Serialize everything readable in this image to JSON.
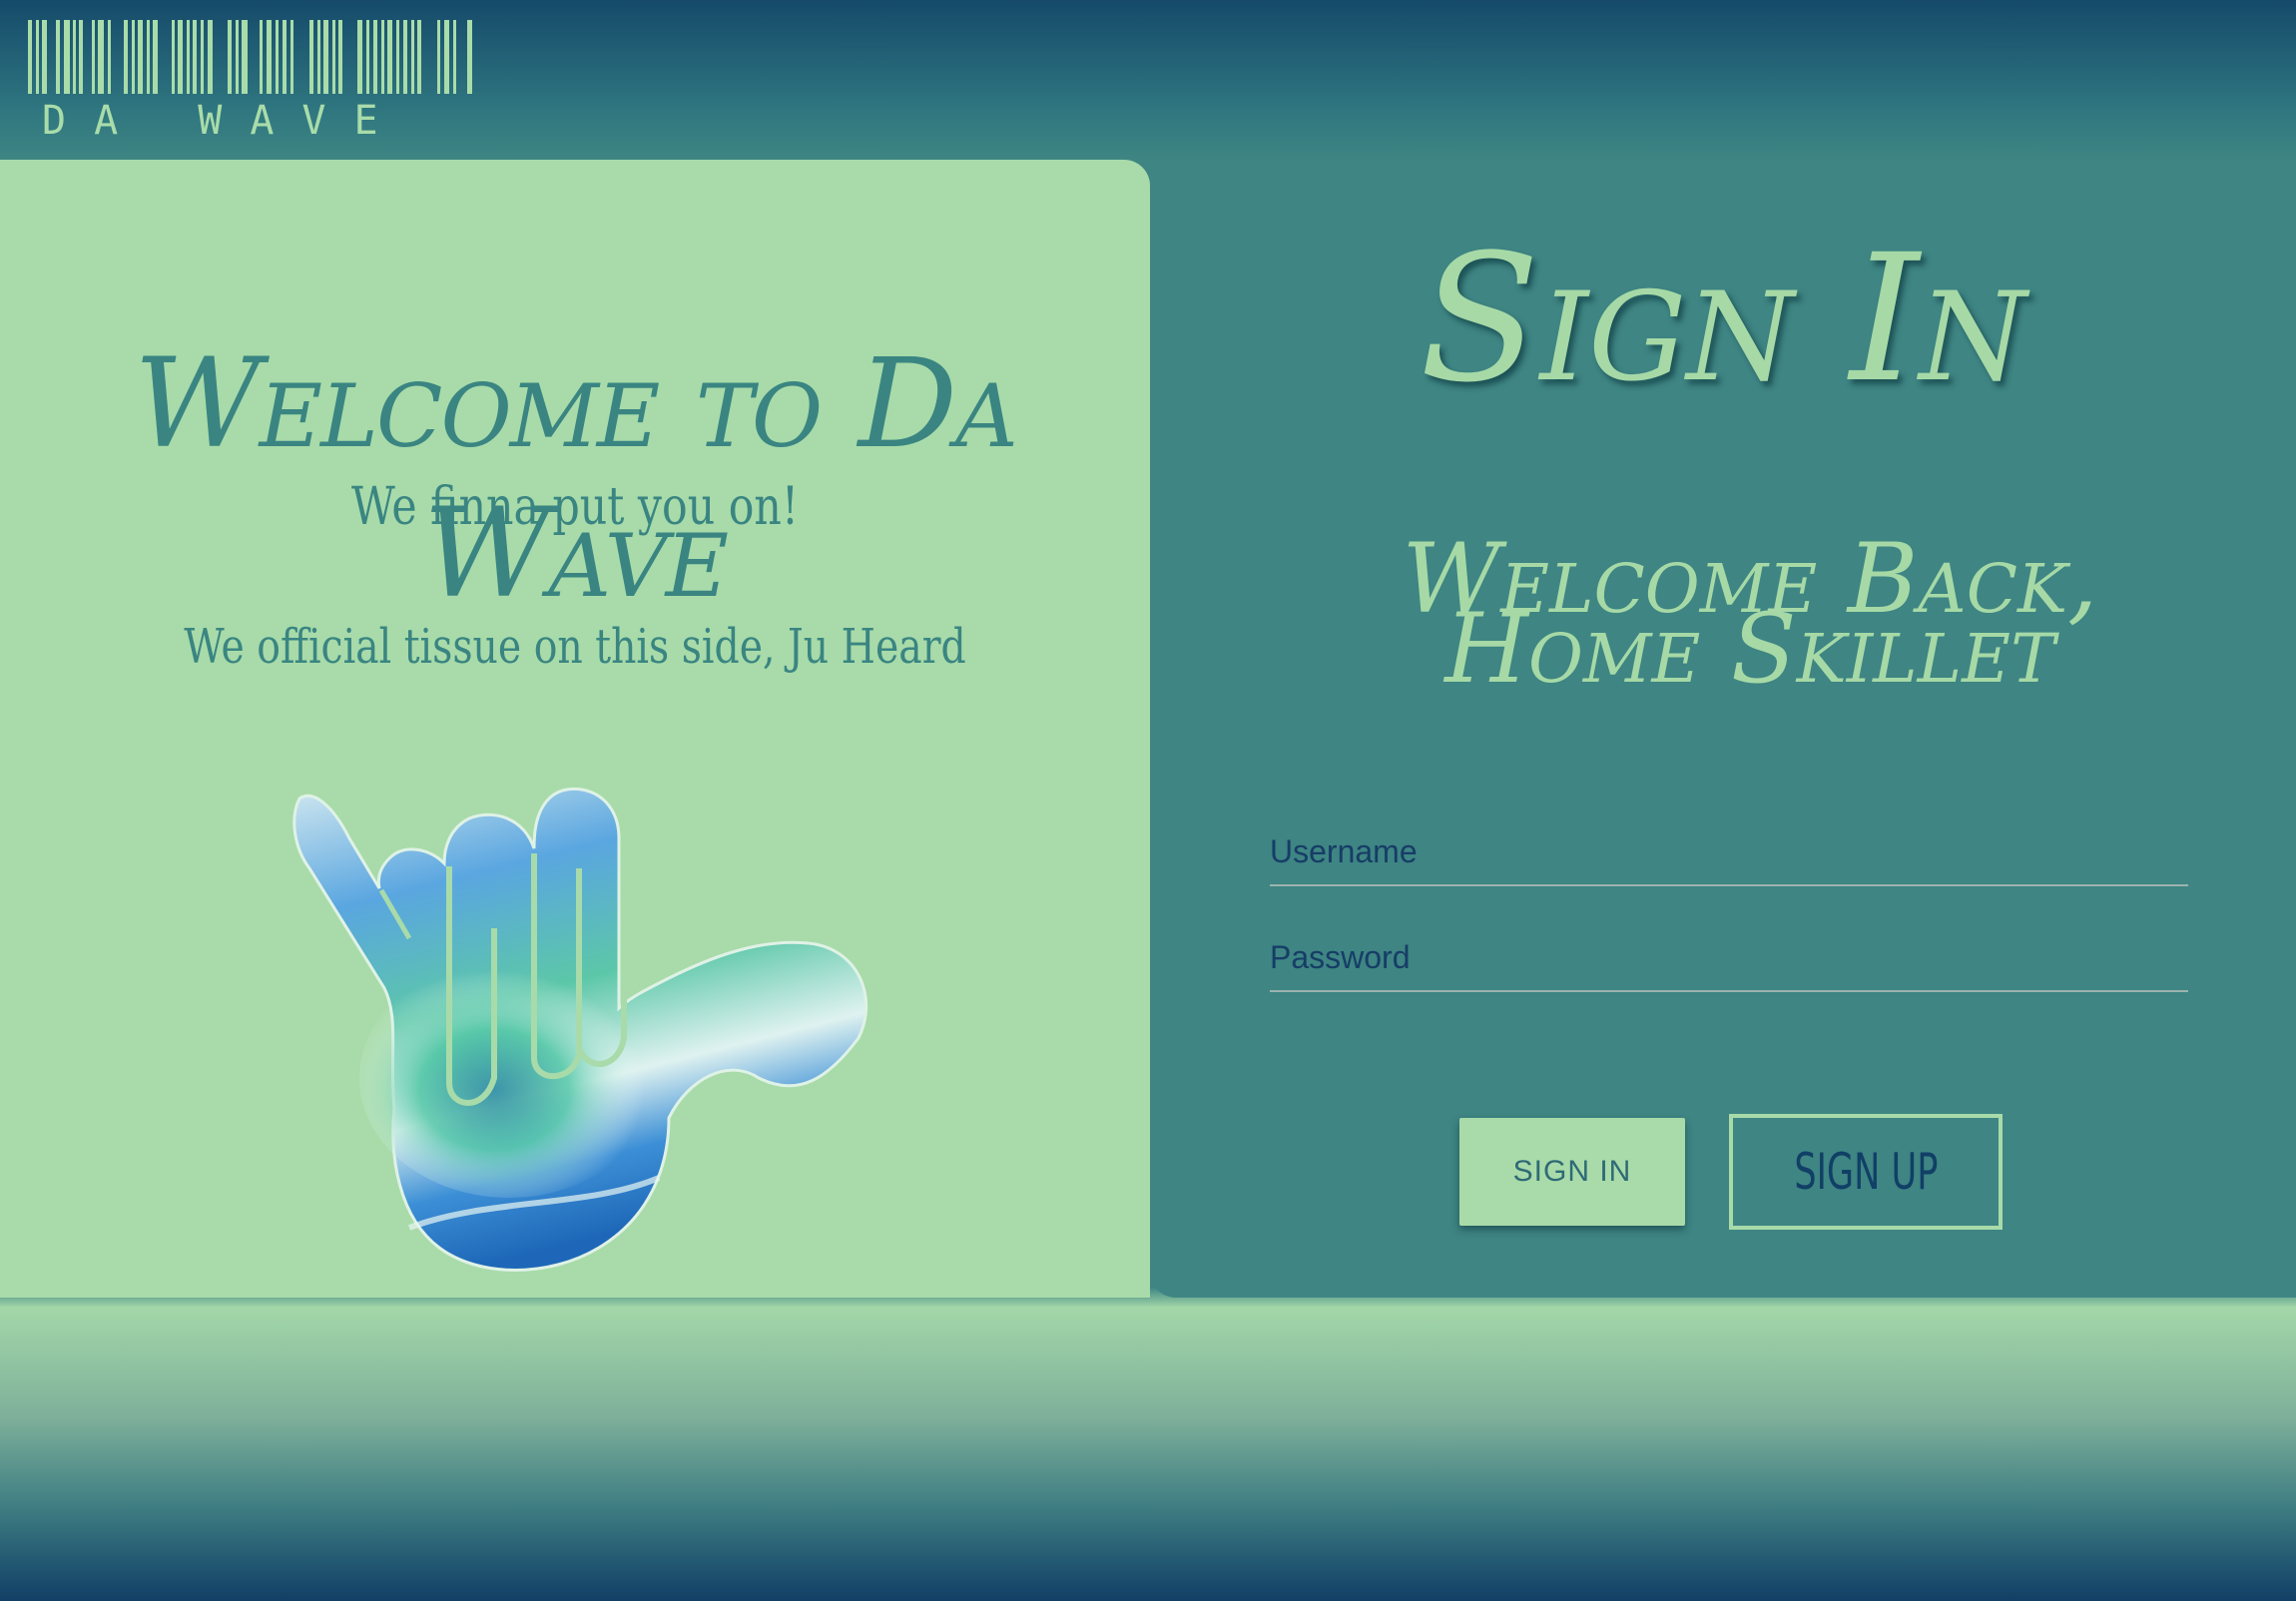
{
  "header": {
    "logo_text": "DA WAVE",
    "barcode_icon": "barcode-icon"
  },
  "welcome": {
    "title": "Welcome to Da Wave",
    "subtitle": "We finna put you on!",
    "tagline": "We official tissue on this side, Ju Heard",
    "image": "shaka-hand-wave-image"
  },
  "signin": {
    "title": "Sign In",
    "greeting": "Welcome Back, Home Skillet",
    "username_placeholder": "Username",
    "password_placeholder": "Password",
    "signin_label": "SIGN IN",
    "signup_label": "SIGN UP"
  },
  "colors": {
    "mint": "#a8dba9",
    "teal": "#3e8583",
    "navy": "#113f66"
  }
}
